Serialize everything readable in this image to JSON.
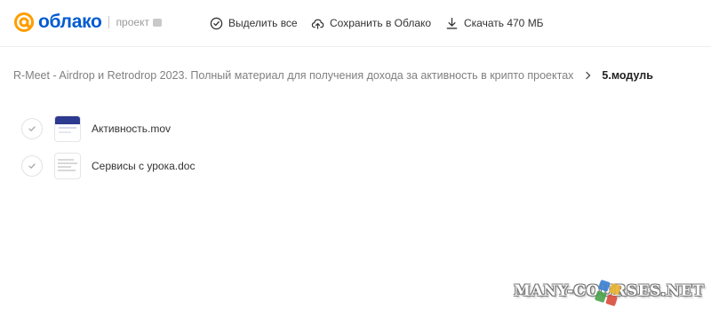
{
  "header": {
    "logo_text": "облако",
    "logo_sub": "проект",
    "actions": {
      "select_all": "Выделить все",
      "save_to_cloud": "Сохранить в Облако",
      "download": "Скачать 470 МБ"
    }
  },
  "breadcrumb": {
    "parent": "R-Meet - Airdrop и Retrodrop 2023. Полный материал для получения дохода за активность в крипто проектах",
    "current": "5.модуль"
  },
  "files": [
    {
      "name": "Активность.mov",
      "type": "video"
    },
    {
      "name": "Сервисы с урока.doc",
      "type": "document"
    }
  ],
  "watermark": {
    "text": "MANY-COURSES.NET"
  },
  "colors": {
    "brand_orange": "#ff9e00",
    "brand_blue": "#005bd1",
    "text_primary": "#333333",
    "text_muted": "#808080"
  }
}
